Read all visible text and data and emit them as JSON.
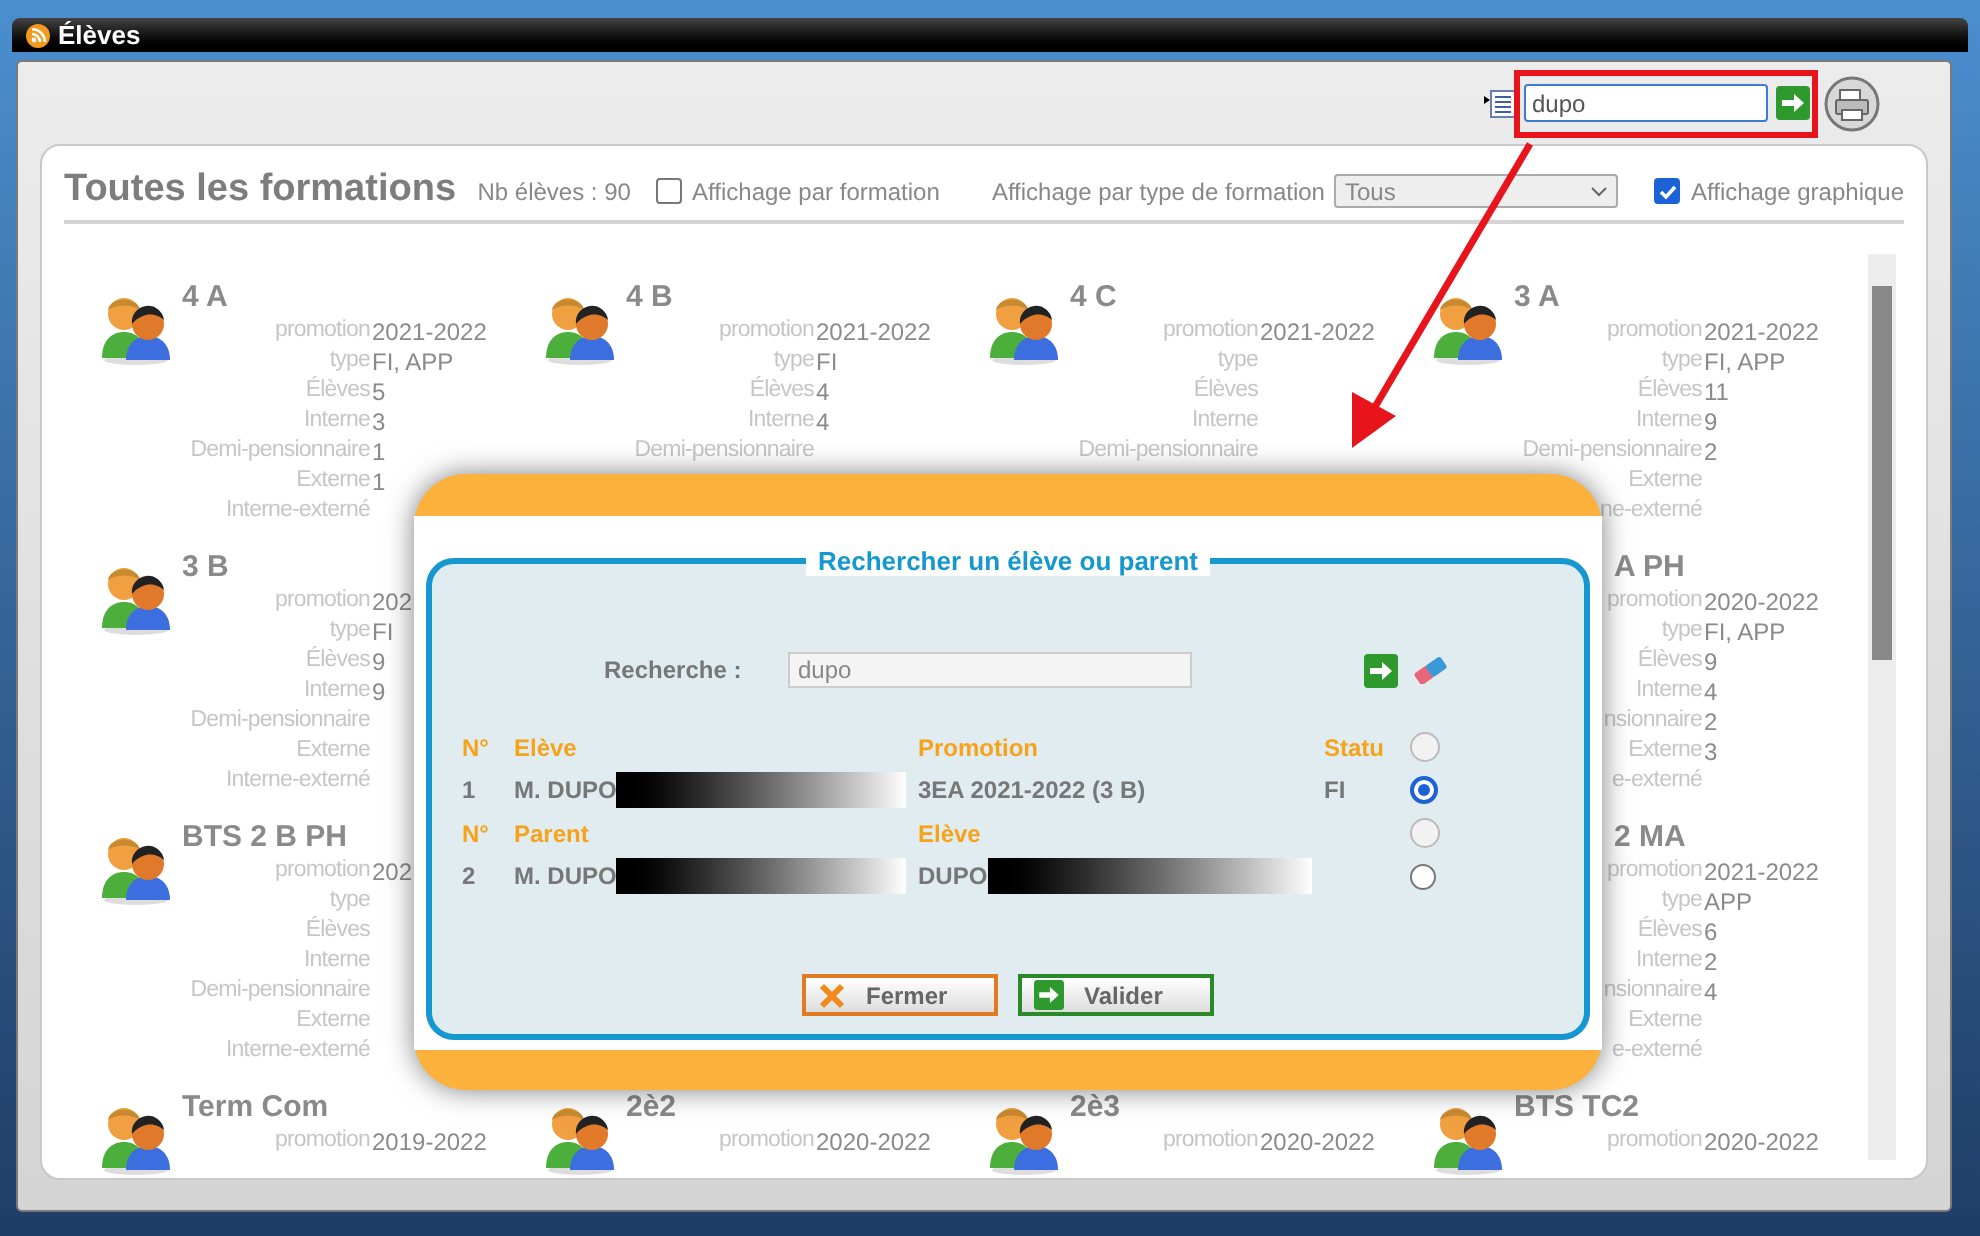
{
  "window": {
    "title": "Élèves"
  },
  "toolbar": {
    "search": {
      "value": "dupo",
      "highlighted": true
    }
  },
  "header": {
    "title": "Toutes les formations",
    "count": "Nb élèves : 90",
    "options": [
      {
        "kind": "checkbox",
        "label": "Affichage par formation",
        "checked": false
      },
      {
        "kind": "select",
        "label": "Affichage par type de formation",
        "value": "Tous"
      },
      {
        "kind": "checkbox",
        "label": "Affichage graphique",
        "checked": true
      }
    ]
  },
  "formation_rows": [
    {
      "cards": [
        {
          "title": "4 A",
          "partly_hidden": false,
          "fields": [
            {
              "label": "promotion",
              "value": "2021-2022"
            },
            {
              "label": "type",
              "value": "FI, APP"
            },
            {
              "label": "Élèves",
              "value": "5"
            },
            {
              "label": "Interne",
              "value": "3"
            },
            {
              "label": "Demi-pensionnaire",
              "value": "1"
            },
            {
              "label": "Externe",
              "value": "1"
            },
            {
              "label": "Interne-externé"
            }
          ]
        },
        {
          "title": "4 B",
          "partly_hidden": false,
          "fields": [
            {
              "label": "promotion",
              "value": "2021-2022"
            },
            {
              "label": "type",
              "value": "FI"
            },
            {
              "label": "Élèves",
              "value": "4"
            },
            {
              "label": "Interne",
              "value": "4"
            },
            {
              "label": "Demi-pensionnaire"
            }
          ]
        },
        {
          "title": "4 C",
          "partly_hidden": false,
          "fields": [
            {
              "label": "promotion",
              "value": "2021-2022"
            },
            {
              "label": "type"
            },
            {
              "label": "Élèves"
            },
            {
              "label": "Interne"
            },
            {
              "label": "Demi-pensionnaire"
            }
          ]
        },
        {
          "title": "3 A",
          "partly_hidden": false,
          "fields": [
            {
              "label": "promotion",
              "value": "2021-2022"
            },
            {
              "label": "type",
              "value": "FI, APP"
            },
            {
              "label": "Élèves",
              "value": "11"
            },
            {
              "label": "Interne",
              "value": "9"
            },
            {
              "label": "Demi-pensionnaire",
              "value": "2"
            },
            {
              "label": "Externe"
            },
            {
              "label": "ne-externé"
            }
          ]
        }
      ]
    },
    {
      "cards": [
        {
          "title": "3 B",
          "partly_hidden": false,
          "fields": [
            {
              "label": "promotion",
              "value": "202"
            },
            {
              "label": "type",
              "value": "FI"
            },
            {
              "label": "Élèves",
              "value": "9"
            },
            {
              "label": "Interne",
              "value": "9"
            },
            {
              "label": "Demi-pensionnaire"
            },
            {
              "label": "Externe"
            },
            {
              "label": "Interne-externé"
            }
          ]
        },
        {
          "title": "A PH",
          "partly_hidden": true,
          "fields": [
            {
              "label": "promotion",
              "value": "2020-2022"
            },
            {
              "label": "type",
              "value": "FI, APP"
            },
            {
              "label": "Élèves",
              "value": "9"
            },
            {
              "label": "Interne",
              "value": "4"
            },
            {
              "label": "nsionnaire",
              "value": "2"
            },
            {
              "label": "Externe",
              "value": "3"
            },
            {
              "label": "e-externé"
            }
          ]
        }
      ]
    },
    {
      "cards": [
        {
          "title": "BTS 2 B PH",
          "partly_hidden": false,
          "fields": [
            {
              "label": "promotion",
              "value": "202"
            },
            {
              "label": "type"
            },
            {
              "label": "Élèves"
            },
            {
              "label": "Interne"
            },
            {
              "label": "Demi-pensionnaire"
            },
            {
              "label": "Externe"
            },
            {
              "label": "Interne-externé"
            }
          ]
        },
        {
          "title": "2 MA",
          "partly_hidden": true,
          "fields": [
            {
              "label": "promotion",
              "value": "2021-2022"
            },
            {
              "label": "type",
              "value": "APP"
            },
            {
              "label": "Élèves",
              "value": "6"
            },
            {
              "label": "Interne",
              "value": "2"
            },
            {
              "label": "nsionnaire",
              "value": "4"
            },
            {
              "label": "Externe"
            },
            {
              "label": "e-externé"
            }
          ]
        }
      ]
    },
    {
      "cards": [
        {
          "title": "Term Com",
          "partly_hidden": false,
          "fields": [
            {
              "label": "promotion",
              "value": "2019-2022"
            }
          ]
        },
        {
          "title": "2è2",
          "partly_hidden": false,
          "fields": [
            {
              "label": "promotion",
              "value": "2020-2022"
            }
          ]
        },
        {
          "title": "2è3",
          "partly_hidden": false,
          "fields": [
            {
              "label": "promotion",
              "value": "2020-2022"
            }
          ]
        },
        {
          "title": "BTS TC2",
          "partly_hidden": false,
          "fields": [
            {
              "label": "promotion",
              "value": "2020-2022"
            }
          ]
        }
      ]
    }
  ],
  "dialog": {
    "legend": "Rechercher un élève ou parent",
    "search": {
      "label": "Recherche :",
      "value": "dupo"
    },
    "results": [
      {
        "kind": "header",
        "cells": [
          {
            "text": "N°"
          },
          {
            "text": "Elève"
          },
          {
            "text": "Promotion"
          },
          {
            "text": "Statu"
          }
        ],
        "radio": {
          "selected": false,
          "disabled": true
        }
      },
      {
        "kind": "row",
        "cells": [
          {
            "text": "1"
          },
          {
            "text": "M. DUPO",
            "redacted": true
          },
          {
            "text": "3EA 2021-2022 (3 B)"
          },
          {
            "text": "FI"
          }
        ],
        "radio": {
          "selected": true,
          "disabled": false
        }
      },
      {
        "kind": "header",
        "cells": [
          {
            "text": "N°"
          },
          {
            "text": "Parent"
          },
          {
            "text": "Elève"
          }
        ],
        "radio": {
          "selected": false,
          "disabled": true
        }
      },
      {
        "kind": "row",
        "cells": [
          {
            "text": "2"
          },
          {
            "text": "M. DUPO",
            "redacted": true
          },
          {
            "text": "DUPO",
            "redacted": true
          }
        ],
        "radio": {
          "selected": false,
          "disabled": false
        }
      }
    ],
    "buttons": [
      {
        "kind": "close",
        "label": "Fermer"
      },
      {
        "kind": "confirm",
        "label": "Valider"
      }
    ]
  }
}
